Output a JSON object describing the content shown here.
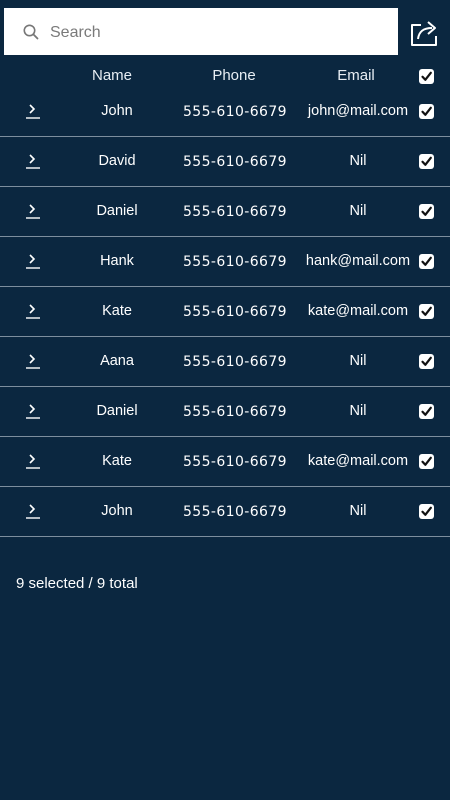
{
  "search": {
    "placeholder": "Search",
    "value": ""
  },
  "toolbar": {
    "share_icon": "share-icon"
  },
  "columns": {
    "name": "Name",
    "phone": "Phone",
    "email": "Email"
  },
  "select_all_checked": true,
  "rows": [
    {
      "name": "John",
      "phone": "555-610-6679",
      "email": "john@mail.com",
      "checked": true
    },
    {
      "name": "David",
      "phone": "555-610-6679",
      "email": "Nil",
      "checked": true
    },
    {
      "name": "Daniel",
      "phone": "555-610-6679",
      "email": "Nil",
      "checked": true
    },
    {
      "name": "Hank",
      "phone": "555-610-6679",
      "email": "hank@mail.com",
      "checked": true
    },
    {
      "name": "Kate",
      "phone": "555-610-6679",
      "email": "kate@mail.com",
      "checked": true
    },
    {
      "name": "Aana",
      "phone": "555-610-6679",
      "email": "Nil",
      "checked": true
    },
    {
      "name": "Daniel",
      "phone": "555-610-6679",
      "email": "Nil",
      "checked": true
    },
    {
      "name": "Kate",
      "phone": "555-610-6679",
      "email": "kate@mail.com",
      "checked": true
    },
    {
      "name": "John",
      "phone": "555-610-6679",
      "email": "Nil",
      "checked": true
    }
  ],
  "footer": {
    "status": "9 selected / 9 total"
  },
  "colors": {
    "background": "#0b2740",
    "divider": "#7d8e9e",
    "text": "#ffffff"
  }
}
